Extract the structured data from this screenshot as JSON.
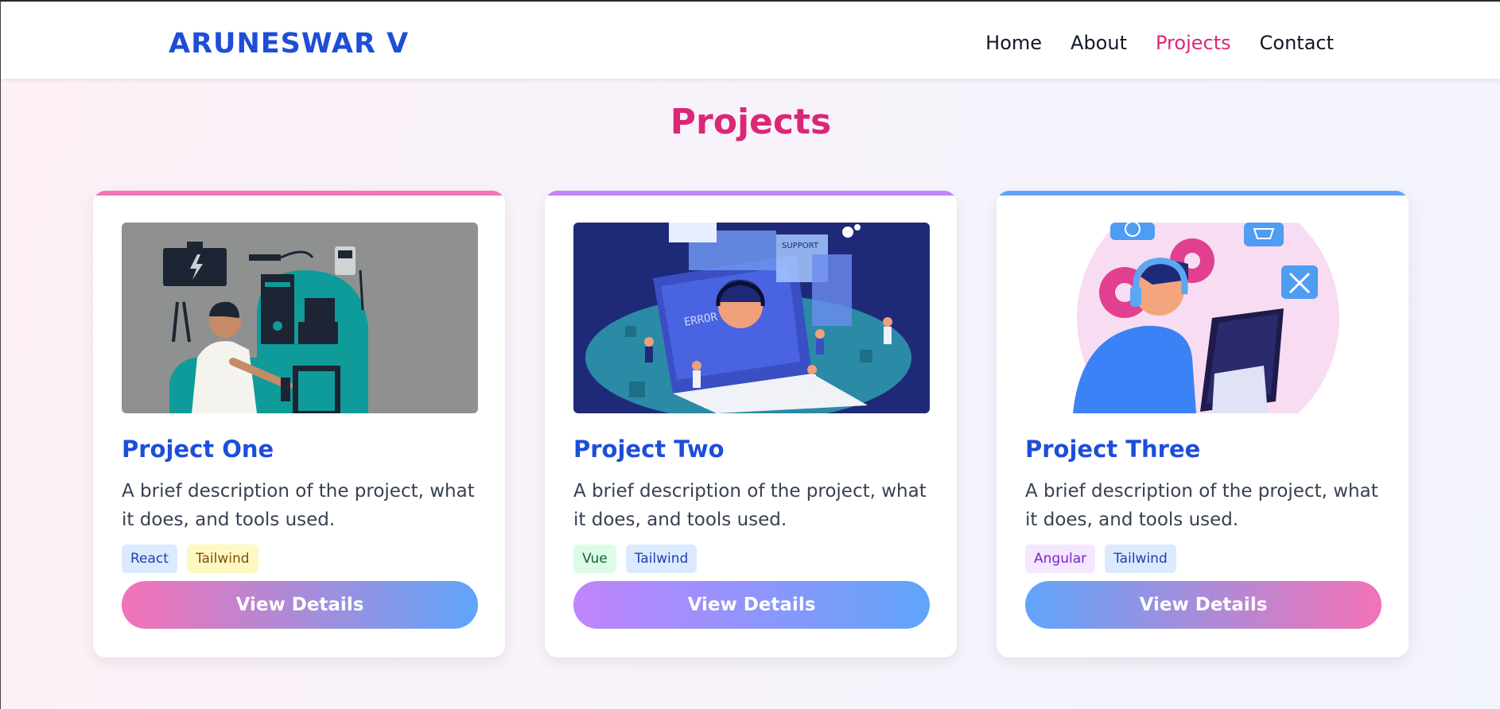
{
  "brand": "ARUNESWAR V",
  "nav": [
    {
      "label": "Home",
      "active": false
    },
    {
      "label": "About",
      "active": false
    },
    {
      "label": "Projects",
      "active": true
    },
    {
      "label": "Contact",
      "active": false
    }
  ],
  "section_title": "Projects",
  "projects": [
    {
      "title": "Project One",
      "description": "A brief description of the project, what it does, and tools used.",
      "tags": [
        "React",
        "Tailwind"
      ],
      "button": "View Details",
      "accent": "#f472b6"
    },
    {
      "title": "Project Two",
      "description": "A brief description of the project, what it does, and tools used.",
      "tags": [
        "Vue",
        "Tailwind"
      ],
      "button": "View Details",
      "accent": "#c084fc"
    },
    {
      "title": "Project Three",
      "description": "A brief description of the project, what it does, and tools used.",
      "tags": [
        "Angular",
        "Tailwind"
      ],
      "button": "View Details",
      "accent": "#60a5fa"
    }
  ],
  "illustration_text": {
    "error": "ERROR",
    "support": "SUPPORT"
  },
  "colors": {
    "brand": "#1d4ed8",
    "active_nav": "#db2777",
    "heading": "#db2777",
    "pink": "#f472b6",
    "purple": "#c084fc",
    "blue": "#60a5fa"
  }
}
